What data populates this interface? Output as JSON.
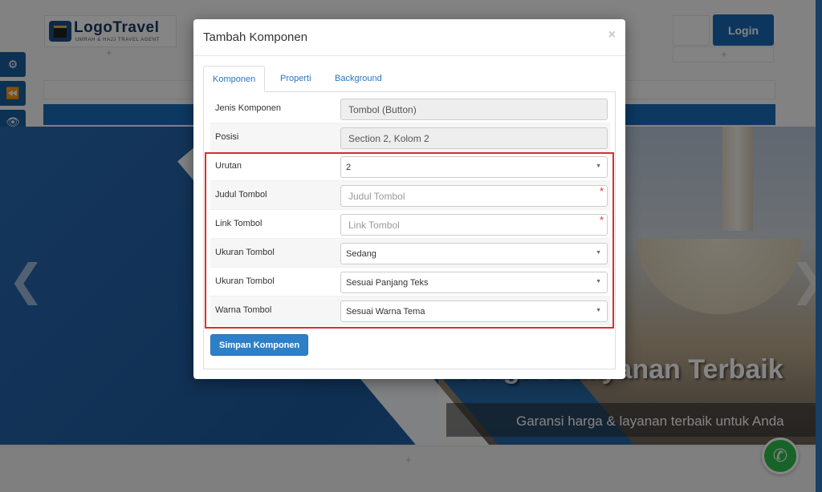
{
  "page": {
    "logo": {
      "text": "LogoTravel",
      "subtitle": "UMRAH & HAJJ TRAVEL AGENT"
    },
    "login_label": "Login",
    "plus_symbol": "+",
    "side_tools": [
      {
        "icon": "gears-icon",
        "glyph": "⚙"
      },
      {
        "icon": "rewind-icon",
        "glyph": "⏪"
      },
      {
        "icon": "eye-icon",
        "glyph": "👁"
      },
      {
        "icon": "check-icon",
        "glyph": "✔"
      }
    ],
    "hero": {
      "title": "Harga & Layanan Terbaik",
      "caption": "Garansi harga & layanan terbaik untuk Anda",
      "prev_glyph": "❮",
      "next_glyph": "❯"
    },
    "whatsapp_glyph": "✆"
  },
  "modal": {
    "title": "Tambah Komponen",
    "close_glyph": "×",
    "tabs": [
      {
        "label": "Komponen",
        "active": true
      },
      {
        "label": "Properti",
        "active": false
      },
      {
        "label": "Background",
        "active": false
      }
    ],
    "fields": {
      "jenis": {
        "label": "Jenis Komponen",
        "value": "Tombol (Button)"
      },
      "posisi": {
        "label": "Posisi",
        "value": "Section 2, Kolom 2"
      },
      "urutan": {
        "label": "Urutan",
        "value": "2"
      },
      "judul": {
        "label": "Judul Tombol",
        "placeholder": "Judul Tombol",
        "required": "*"
      },
      "link": {
        "label": "Link Tombol",
        "placeholder": "Link Tombol",
        "required": "*"
      },
      "ukuran": {
        "label": "Ukuran Tombol",
        "value": "Sedang"
      },
      "ukuran_lebar": {
        "label": "Ukuran Tombol",
        "value": "Sesuai Panjang Teks"
      },
      "warna": {
        "label": "Warna Tombol",
        "value": "Sesuai Warna Tema"
      }
    },
    "caret_glyph": "▼",
    "save_label": "Simpan Komponen"
  },
  "colors": {
    "primary": "#1769b5",
    "highlight": "#d9302b",
    "link": "#2a75c0",
    "whatsapp": "#2fbf4d"
  }
}
